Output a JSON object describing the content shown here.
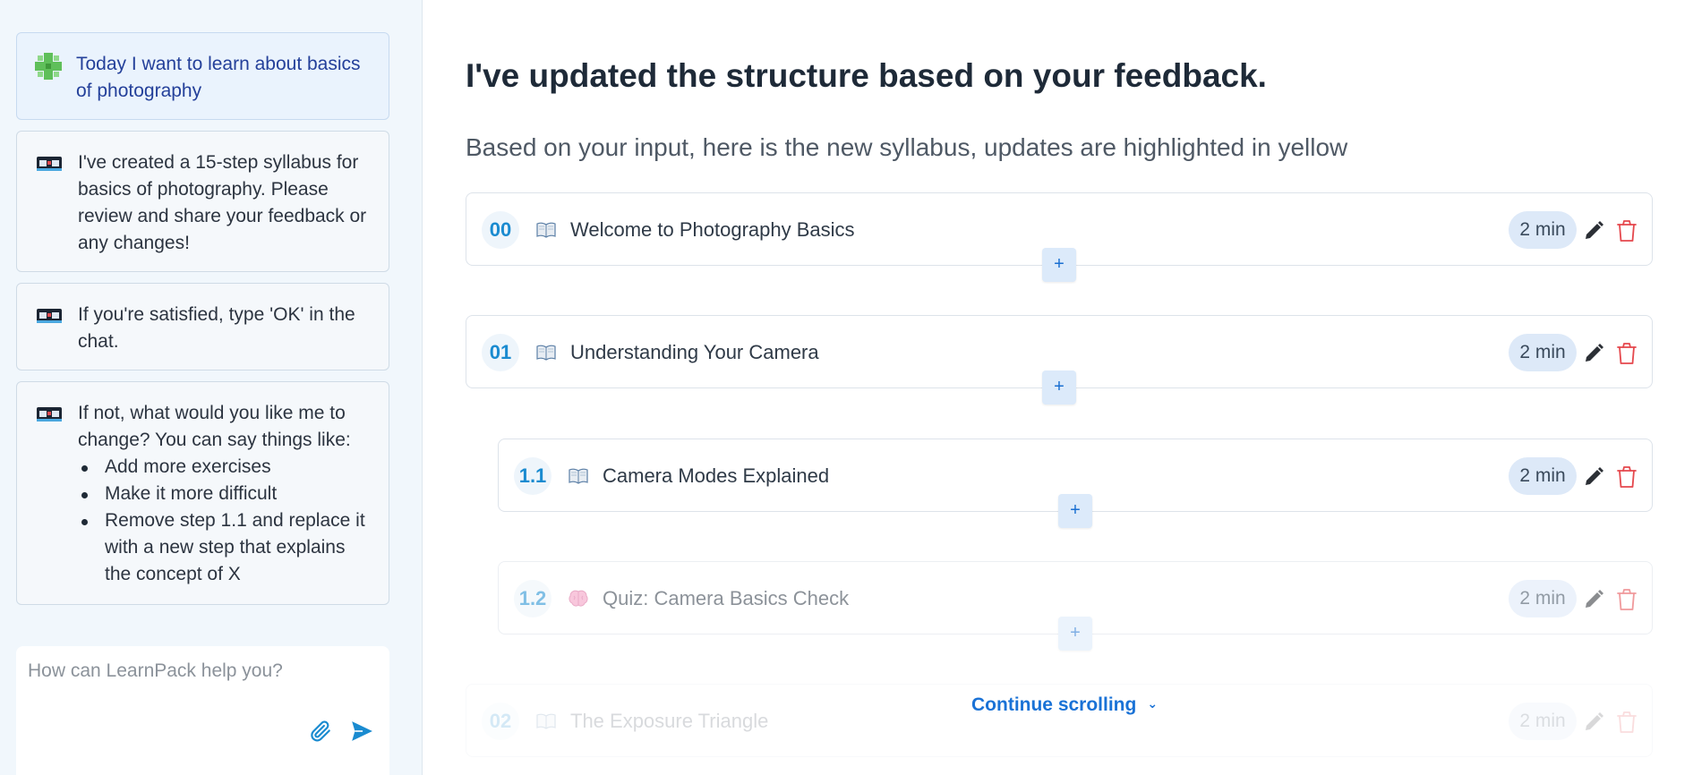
{
  "chat": {
    "messages": [
      {
        "role": "user",
        "text": "Today I want to learn about basics of photography"
      },
      {
        "role": "bot",
        "text": "I've created a 15-step syllabus for basics of photography. Please review and share your feedback or any changes!"
      },
      {
        "role": "bot",
        "text": "If you're satisfied, type 'OK' in the chat."
      },
      {
        "role": "bot",
        "intro": "If not, what would you like me to change? You can say things like:",
        "items": [
          "Add more exercises",
          "Make it more difficult",
          "Remove step 1.1 and replace it with a new step that explains the concept of X"
        ]
      }
    ],
    "input_placeholder": "How can LearnPack help you?",
    "icons": {
      "attach": "paperclip-icon",
      "send": "send-icon"
    }
  },
  "main": {
    "title": "I've updated the structure based on your feedback.",
    "subtitle": "Based on your input, here is the new syllabus, updates are highlighted in yellow",
    "steps": [
      {
        "num": "00",
        "kind": "book",
        "title": "Welcome to Photography Basics",
        "duration": "2 min"
      },
      {
        "num": "01",
        "kind": "book",
        "title": "Understanding Your Camera",
        "duration": "2 min"
      },
      {
        "num": "1.1",
        "kind": "book",
        "title": "Camera Modes Explained",
        "duration": "2 min"
      },
      {
        "num": "1.2",
        "kind": "brain",
        "title": "Quiz: Camera Basics Check",
        "duration": "2 min"
      },
      {
        "num": "02",
        "kind": "book",
        "title": "The Exposure Triangle",
        "duration": "2 min"
      }
    ],
    "add_label": "+",
    "continue_label": "Continue scrolling",
    "colors": {
      "accent": "#1a72d6",
      "num": "#1a8bd0",
      "delete": "#e5484d"
    }
  }
}
